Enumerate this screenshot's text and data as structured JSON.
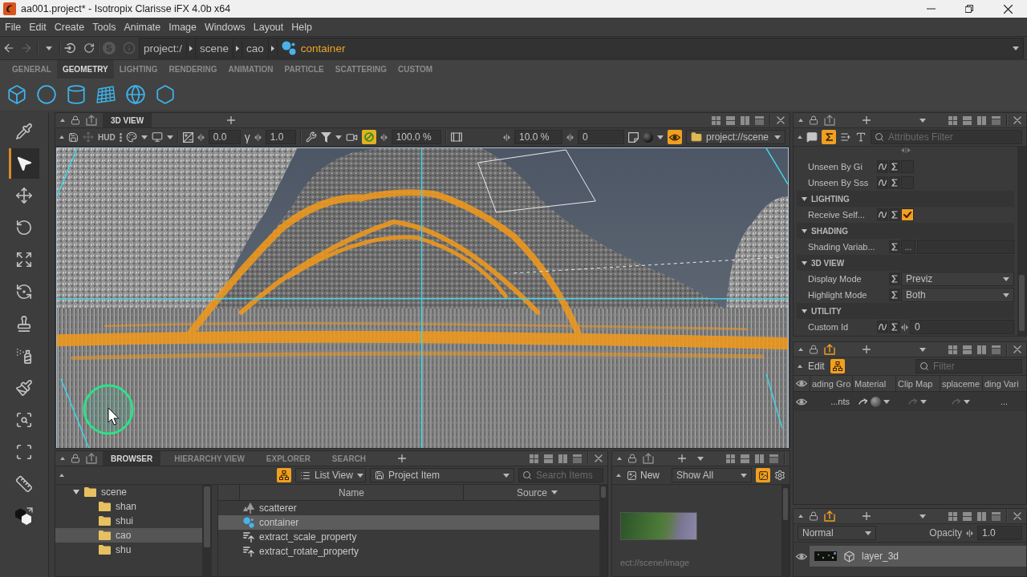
{
  "window": {
    "title": "aa001.project* - Isotropix Clarisse iFX 4.0b x64"
  },
  "menu": [
    "File",
    "Edit",
    "Create",
    "Tools",
    "Animate",
    "Image",
    "Windows",
    "Layout",
    "Help"
  ],
  "address_bar": {
    "forward_disabled": true,
    "round_button_label": "S",
    "path": [
      {
        "label": "project:/",
        "kind": "folder"
      },
      {
        "label": "scene",
        "kind": "folder"
      },
      {
        "label": "cao",
        "kind": "folder"
      },
      {
        "label": "container",
        "kind": "container"
      }
    ]
  },
  "shelf": {
    "tabs": [
      {
        "label": "GENERAL",
        "selected": false
      },
      {
        "label": "GEOMETRY",
        "selected": true
      },
      {
        "label": "LIGHTING",
        "selected": false
      },
      {
        "label": "RENDERING",
        "selected": false
      },
      {
        "label": "ANIMATION",
        "selected": false
      },
      {
        "label": "PARTICLE",
        "selected": false
      },
      {
        "label": "SCATTERING",
        "selected": false
      },
      {
        "label": "CUSTOM",
        "selected": false
      }
    ]
  },
  "toolbox": [
    {
      "kind": "picker",
      "selected": false
    },
    {
      "kind": "select",
      "selected": true
    },
    {
      "kind": "move",
      "selected": false
    },
    {
      "kind": "rotate",
      "selected": false
    },
    {
      "kind": "scale",
      "selected": false
    },
    {
      "kind": "orbit",
      "selected": false
    },
    {
      "kind": "stamp",
      "selected": false
    },
    {
      "kind": "paint",
      "selected": false
    },
    {
      "kind": "brush",
      "selected": false
    },
    {
      "kind": "frame",
      "selected": false
    },
    {
      "kind": "frame_object",
      "selected": false
    },
    {
      "kind": "measure",
      "selected": false
    },
    {
      "kind": "swap",
      "selected": false
    }
  ],
  "viewport": {
    "header_toggle_on": false,
    "tabs": [
      {
        "label": "3D VIEW",
        "selected": true
      }
    ],
    "toolbar": {
      "hud_label": "HUD",
      "exposure": "0.0",
      "gamma_symbol": "γ",
      "gamma": "1.0",
      "ring_toggle_on": true,
      "percent_1": "100.0 %",
      "percent_2": "10.0 %",
      "number": "0",
      "eye_toggle_on": true,
      "path": "project://scene"
    }
  },
  "browser": {
    "header_toggle_on": false,
    "tabs": [
      {
        "label": "BROWSER",
        "selected": true
      },
      {
        "label": "HIERARCHY VIEW",
        "selected": false
      },
      {
        "label": "EXPLORER",
        "selected": false
      },
      {
        "label": "SEARCH",
        "selected": false
      }
    ],
    "tree_toggle_on": true,
    "view_mode": "List View",
    "filter": "Project Item",
    "search": {
      "placeholder": "Search Items"
    },
    "tree": [
      {
        "label": "scene",
        "expanded": true,
        "selected": false,
        "children": [
          {
            "label": "shan",
            "selected": false
          },
          {
            "label": "shui",
            "selected": false
          },
          {
            "label": "cao",
            "selected": true
          },
          {
            "label": "shu",
            "selected": false
          }
        ]
      }
    ],
    "columns": [
      {
        "label": "Name",
        "menu": false
      },
      {
        "label": "Source",
        "menu": true
      }
    ],
    "rows": [
      {
        "name": "scatterer",
        "kind": "scatterer",
        "selected": false
      },
      {
        "name": "container",
        "kind": "container",
        "selected": true
      },
      {
        "name": "extract_scale_property",
        "kind": "property",
        "selected": false
      },
      {
        "name": "extract_rotate_property",
        "kind": "property",
        "selected": false
      }
    ]
  },
  "image_panel": {
    "header_toggle_on": false,
    "new_label": "New",
    "filter": "Show All",
    "preview_toggle_on": true,
    "images": [
      {
        "caption": "ect://scene/image"
      }
    ]
  },
  "attributes": {
    "header_toggle_on": false,
    "sigma_toggle_on": true,
    "search": {
      "placeholder": "Attributes Filter"
    },
    "rows": [
      {
        "kind": "checkbox",
        "label": "Unseen By Gi",
        "checked": false
      },
      {
        "kind": "checkbox",
        "label": "Unseen By Sss",
        "checked": false
      },
      {
        "kind": "section",
        "label": "LIGHTING",
        "expanded": true
      },
      {
        "kind": "checkbox",
        "label": "Receive Self...",
        "checked": true
      },
      {
        "kind": "section",
        "label": "SHADING",
        "expanded": true
      },
      {
        "kind": "reference",
        "label": "Shading Variab...",
        "button": "..."
      },
      {
        "kind": "section",
        "label": "3D VIEW",
        "expanded": true
      },
      {
        "kind": "dropdown",
        "label": "Display Mode",
        "value": "Previz"
      },
      {
        "kind": "dropdown",
        "label": "Highlight Mode",
        "value": "Both"
      },
      {
        "kind": "section",
        "label": "UTILITY",
        "expanded": true
      },
      {
        "kind": "number",
        "label": "Custom Id",
        "value": "0"
      }
    ]
  },
  "objects": {
    "header_toggle_on": true,
    "edit_label": "Edit",
    "hierarchy_toggle_on": true,
    "search": {
      "placeholder": "Filter"
    },
    "columns": [
      "ading Gro",
      "Material",
      "Clip Map",
      "splaceme",
      "ding Vari"
    ],
    "rows": [
      {
        "column_1": "...nts",
        "column_5": "..."
      }
    ]
  },
  "layers": {
    "header_toggle_on": true,
    "blend_mode": "Normal",
    "opacity_label": "Opacity",
    "opacity": "1.0",
    "items": [
      {
        "name": "layer_3d",
        "selected": true
      }
    ]
  }
}
